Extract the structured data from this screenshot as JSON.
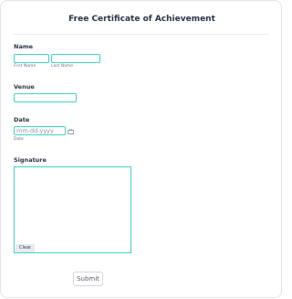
{
  "form": {
    "title": "Free Certificate of Achievement"
  },
  "name_field": {
    "label": "Name",
    "first_sublabel": "First Name",
    "last_sublabel": "Last Name",
    "first_value": "",
    "last_value": ""
  },
  "venue_field": {
    "label": "Venue",
    "value": ""
  },
  "date_field": {
    "label": "Date",
    "placeholder": "mm-dd-yyyy",
    "sublabel": "Date",
    "icon": "calendar-icon"
  },
  "signature_field": {
    "label": "Signature",
    "clear_label": "Clear"
  },
  "actions": {
    "submit_label": "Submit"
  },
  "colors": {
    "input_border": "#41d3c4",
    "text": "#2c3345"
  }
}
